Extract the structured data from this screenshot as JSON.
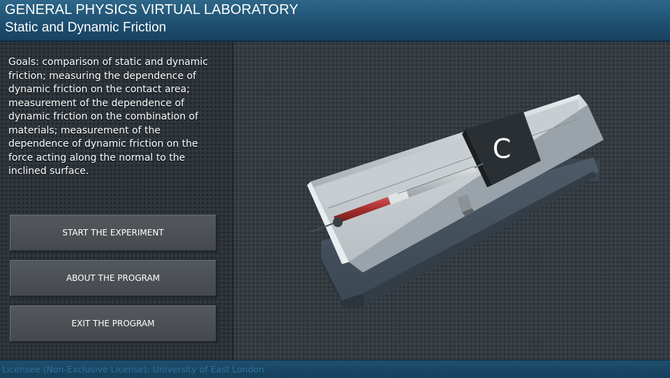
{
  "header": {
    "title": "GENERAL PHYSICS VIRTUAL LABORATORY",
    "subtitle": "Static and Dynamic Friction"
  },
  "goals_text": "Goals: comparison of static and dynamic friction; measuring the dependence of dynamic friction on the contact area; measurement of the dependence of dynamic friction on the combination of materials; measurement of the dependence of dynamic friction on the force acting along the normal to the inclined surface.",
  "menu": {
    "start_label": "START THE EXPERIMENT",
    "about_label": "ABOUT THE PROGRAM",
    "exit_label": "EXIT THE PROGRAM"
  },
  "footer": {
    "license_text": "Licensee (Non-Exclusive License): University of East London"
  },
  "apparatus": {
    "block_label": "C"
  },
  "colors": {
    "header_blue": "#1f5072",
    "button_gray": "#4b5054",
    "footer_text": "#2f7099",
    "spring_red": "#b83a3a"
  }
}
